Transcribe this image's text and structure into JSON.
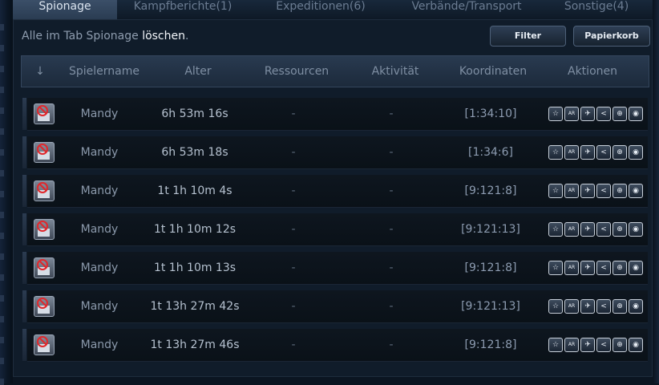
{
  "tabs": [
    {
      "label": "Spionage",
      "active": true
    },
    {
      "label": "Kampfberichte(1)",
      "active": false
    },
    {
      "label": "Expeditionen(6)",
      "active": false
    },
    {
      "label": "Verbände/Transport",
      "active": false
    },
    {
      "label": "Sonstige(4)",
      "active": false
    }
  ],
  "delete_line": {
    "prefix": "Alle im Tab Spionage ",
    "link": "löschen",
    "suffix": "."
  },
  "buttons": {
    "filter": "Filter",
    "trash": "Papierkorb"
  },
  "columns": {
    "sort": "↓",
    "player": "Spielername",
    "age": "Alter",
    "resources": "Ressourcen",
    "activity": "Aktivität",
    "coords": "Koordinaten",
    "actions": "Aktionen"
  },
  "rows": [
    {
      "player": "Mandy",
      "age": "6h 53m 16s",
      "resources": "-",
      "activity": "-",
      "coords": "[1:34:10]"
    },
    {
      "player": "Mandy",
      "age": "6h 53m 18s",
      "resources": "-",
      "activity": "-",
      "coords": "[1:34:6]"
    },
    {
      "player": "Mandy",
      "age": "1t 1h 10m 4s",
      "resources": "-",
      "activity": "-",
      "coords": "[9:121:8]"
    },
    {
      "player": "Mandy",
      "age": "1t 1h 10m 12s",
      "resources": "-",
      "activity": "-",
      "coords": "[9:121:13]"
    },
    {
      "player": "Mandy",
      "age": "1t 1h 10m 13s",
      "resources": "-",
      "activity": "-",
      "coords": "[9:121:8]"
    },
    {
      "player": "Mandy",
      "age": "1t 13h 27m 42s",
      "resources": "-",
      "activity": "-",
      "coords": "[9:121:13]"
    },
    {
      "player": "Mandy",
      "age": "1t 13h 27m 46s",
      "resources": "-",
      "activity": "-",
      "coords": "[9:121:8]"
    }
  ],
  "row_actions": [
    {
      "name": "favorite-icon",
      "glyph": "☆"
    },
    {
      "name": "attack-icon",
      "glyph": "AR"
    },
    {
      "name": "espionage-icon",
      "glyph": "✈"
    },
    {
      "name": "share-icon",
      "glyph": "<"
    },
    {
      "name": "target-icon",
      "glyph": "⊕"
    },
    {
      "name": "view-icon",
      "glyph": "◉"
    }
  ],
  "colors": {
    "accent": "#3b4f68",
    "ban": "#e0282c",
    "background": "#0b1521"
  }
}
